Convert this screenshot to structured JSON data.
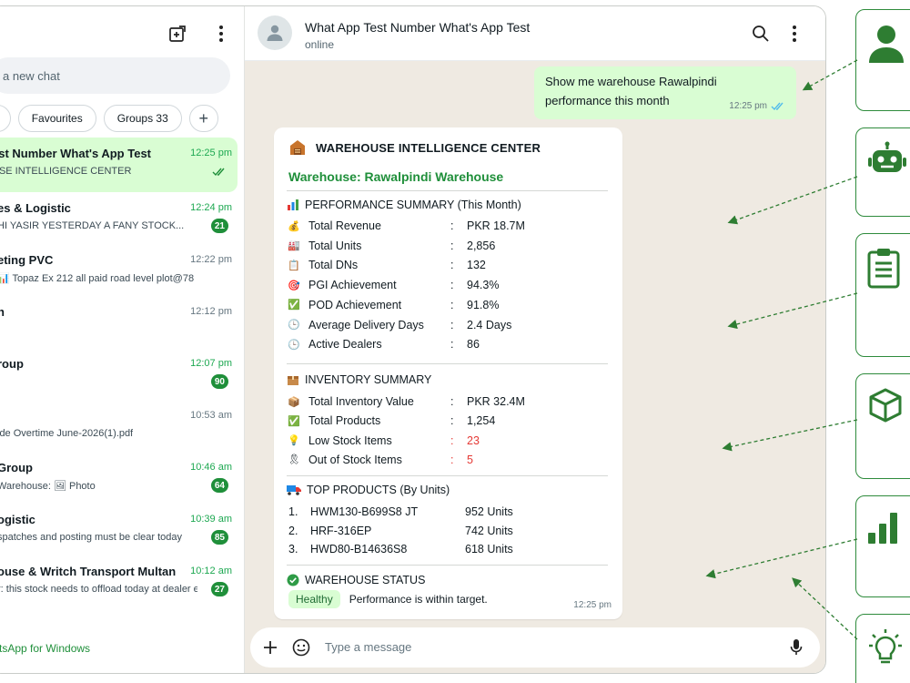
{
  "sidebar": {
    "search_placeholder": "a new chat",
    "filters": [
      {
        "label": "9"
      },
      {
        "label": "Favourites"
      },
      {
        "label": "Groups 33"
      }
    ],
    "chats": [
      {
        "name": "est Number What's App Test",
        "time": "12:25 pm",
        "message": "USE INTELLIGENCE CENTER",
        "badge": "",
        "active": true
      },
      {
        "name": "es & Logistic",
        "time": "12:24 pm",
        "message": "HI YASIR  YESTERDAY A FANY STOCK...",
        "badge": "21"
      },
      {
        "name": "eting PVC",
        "time": "12:22 pm",
        "message": "📊 Topaz Ex 212 all paid road level plot@78",
        "badge": ""
      },
      {
        "name": "n",
        "time": "12:12 pm",
        "message": "",
        "badge": ""
      },
      {
        "name": "roup",
        "time": "12:07 pm",
        "message": "",
        "badge": "90"
      },
      {
        "name": "",
        "time": "10:53 am",
        "message": "ide Overtime June-2026(1).pdf",
        "badge": ""
      },
      {
        "name": "Group",
        "time": "10:46 am",
        "message": "Warehouse: 🖼 Photo",
        "badge": "64"
      },
      {
        "name": "ogistic",
        "time": "10:39 am",
        "message": "spatches and posting must be clear today",
        "badge": "85"
      },
      {
        "name": "ouse & Writch Transport Multan",
        "time": "10:12 am",
        "message": "r: this stock needs to offload today at dealer end",
        "badge": "27"
      }
    ],
    "footer": "tsApp for Windows"
  },
  "chat": {
    "title": "What App Test Number What's App Test",
    "status": "online",
    "outgoing": {
      "line1": "Show me warehouse Rawalpindi",
      "line2": "performance this month",
      "time": "12:25 pm"
    },
    "card": {
      "title": "WAREHOUSE INTELLIGENCE CENTER",
      "warehouse": "Warehouse: Rawalpindi Warehouse",
      "performance_title": "PERFORMANCE SUMMARY (This Month)",
      "performance": [
        {
          "label": "Total Revenue",
          "value": "PKR 18.7M",
          "icon": "💰"
        },
        {
          "label": "Total Units",
          "value": "2,856",
          "icon": "🏭"
        },
        {
          "label": "Total DNs",
          "value": "132",
          "icon": "📋"
        },
        {
          "label": "PGI Achievement",
          "value": "94.3%",
          "icon": "🎯"
        },
        {
          "label": "POD Achievement",
          "value": "91.8%",
          "icon": "✅"
        },
        {
          "label": "Average Delivery Days",
          "value": "2.4 Days",
          "icon": "🕒"
        },
        {
          "label": "Active Dealers",
          "value": "86",
          "icon": "🕒"
        }
      ],
      "inventory_title": "INVENTORY SUMMARY",
      "inventory": [
        {
          "label": "Total Inventory Value",
          "value": "PKR 32.4M",
          "icon": "📦",
          "red": false
        },
        {
          "label": "Total Products",
          "value": "1,254",
          "icon": "✅",
          "red": false
        },
        {
          "label": "Low Stock Items",
          "value": "23",
          "icon": "💡",
          "red": true
        },
        {
          "label": "Out of Stock Items",
          "value": "5",
          "icon": "🎗",
          "red": true
        }
      ],
      "top_title": "TOP PRODUCTS (By Units)",
      "top_products": [
        {
          "rank": "1.",
          "name": "HWM130-B699S8 JT",
          "units": "952 Units"
        },
        {
          "rank": "2.",
          "name": "HRF-316EP",
          "units": "742 Units"
        },
        {
          "rank": "3.",
          "name": "HWD80-B14636S8",
          "units": "618 Units"
        }
      ],
      "status_title": "WAREHOUSE STATUS",
      "status_badge": "Healthy",
      "status_text": "Performance is within target.",
      "time": "12:25 pm"
    },
    "composer_placeholder": "Type a message"
  },
  "colors": {
    "accent": "#1f8f3a",
    "bubble_out": "#d9fdd3",
    "chat_bg": "#efeae2"
  }
}
